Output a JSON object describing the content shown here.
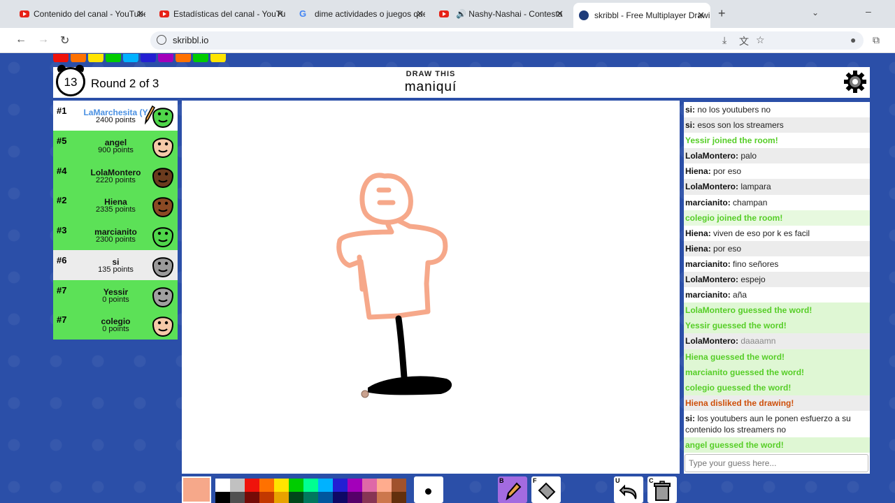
{
  "browser": {
    "tabs": [
      {
        "title": "Contenido del canal - YouTube",
        "icon": "youtube-icon"
      },
      {
        "title": "Estadísticas del canal - YouTube",
        "icon": "youtube-icon"
      },
      {
        "title": "dime actividades o juegos que p",
        "icon": "google-icon"
      },
      {
        "title": "Nashy-Nashai - Contesta El",
        "icon": "youtube-icon"
      },
      {
        "title": "skribbl - Free Multiplayer Drawi",
        "icon": "skribbl-icon",
        "active": true
      }
    ],
    "url": "skribbl.io"
  },
  "header": {
    "timer": "13",
    "round": "Round 2 of 3",
    "draw_label": "DRAW THIS",
    "word": "maniquí"
  },
  "players": [
    {
      "rank": "#1",
      "name": "LaMarchesita (Y",
      "points": "2400 points",
      "me": true,
      "drawing": true,
      "bg": "white",
      "face": "#4fd64a"
    },
    {
      "rank": "#5",
      "name": "angel",
      "points": "900 points",
      "bg": "green",
      "face": "#f5c9a8"
    },
    {
      "rank": "#4",
      "name": "LolaMontero",
      "points": "2220 points",
      "bg": "green",
      "face": "#6b3b1e"
    },
    {
      "rank": "#2",
      "name": "Hiena",
      "points": "2335 points",
      "bg": "green",
      "face": "#8b4a24"
    },
    {
      "rank": "#3",
      "name": "marcianito",
      "points": "2300 points",
      "bg": "green",
      "face": "#4fd64a"
    },
    {
      "rank": "#6",
      "name": "si",
      "points": "135 points",
      "bg": "grey",
      "face": "#9a9a9a"
    },
    {
      "rank": "#7",
      "name": "Yessir",
      "points": "0 points",
      "bg": "green",
      "face": "#a0a0a0"
    },
    {
      "rank": "#7",
      "name": "colegio",
      "points": "0 points",
      "bg": "green",
      "face": "#f5c9a8"
    }
  ],
  "chat": [
    {
      "user": "si",
      "text": "no los youtubers no",
      "type": "msg"
    },
    {
      "user": "si",
      "text": "esos son los streamers",
      "type": "msg"
    },
    {
      "user": "",
      "text": "Yessir joined the room!",
      "type": "guess"
    },
    {
      "user": "LolaMontero",
      "text": "palo",
      "type": "msg"
    },
    {
      "user": "Hiena",
      "text": "por eso",
      "type": "msg"
    },
    {
      "user": "LolaMontero",
      "text": "lampara",
      "type": "msg"
    },
    {
      "user": "marcianito",
      "text": "champan",
      "type": "msg"
    },
    {
      "user": "",
      "text": "colegio joined the room!",
      "type": "guess"
    },
    {
      "user": "Hiena",
      "text": "viven de eso por k es facil",
      "type": "msg"
    },
    {
      "user": "Hiena",
      "text": "por eso",
      "type": "msg"
    },
    {
      "user": "marcianito",
      "text": "fino señores",
      "type": "msg"
    },
    {
      "user": "LolaMontero",
      "text": "espejo",
      "type": "msg"
    },
    {
      "user": "marcianito",
      "text": "aña",
      "type": "msg"
    },
    {
      "user": "",
      "text": "LolaMontero guessed the word!",
      "type": "guessbg"
    },
    {
      "user": "",
      "text": "Yessir guessed the word!",
      "type": "guessbg"
    },
    {
      "user": "LolaMontero",
      "text": "daaaamn",
      "type": "faded"
    },
    {
      "user": "",
      "text": "Hiena guessed the word!",
      "type": "guessbg"
    },
    {
      "user": "",
      "text": "marcianito guessed the word!",
      "type": "guessbg"
    },
    {
      "user": "",
      "text": "colegio guessed the word!",
      "type": "guessbg"
    },
    {
      "user": "",
      "text": "Hiena disliked the drawing!",
      "type": "dislike"
    },
    {
      "user": "si",
      "text": "los youtubers aun le ponen esfuerzo a su contenido los streamers no",
      "type": "msg"
    },
    {
      "user": "",
      "text": "angel guessed the word!",
      "type": "guessbg"
    }
  ],
  "chat_input": {
    "placeholder": "Type your guess here..."
  },
  "toolbar": {
    "current_color": "#f6a88a",
    "palette_top": [
      "#ffffff",
      "#c1c1c1",
      "#ef130b",
      "#ff7100",
      "#ffe400",
      "#00cc00",
      "#00ff91",
      "#00b2ff",
      "#231fd3",
      "#a300ba",
      "#df69a7",
      "#ffac8e",
      "#a0522d"
    ],
    "palette_bottom": [
      "#000000",
      "#505050",
      "#740b07",
      "#c23800",
      "#e8a200",
      "#004619",
      "#00785d",
      "#00569e",
      "#0e0865",
      "#550069",
      "#873554",
      "#cc774d",
      "#63300d"
    ],
    "tool_keys": {
      "brush": "B",
      "fill": "F",
      "undo": "U",
      "clear": "C"
    }
  }
}
